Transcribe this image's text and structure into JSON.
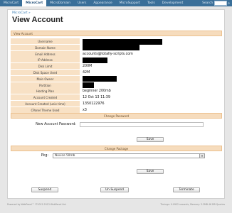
{
  "nav": {
    "items": [
      "MicroCart",
      "MicroCart",
      "MicroDomain",
      "Users",
      "Appearance",
      "MicroSupport",
      "Tools",
      "Development"
    ],
    "active_index": 1,
    "search_label": "Search"
  },
  "breadcrumb": "MicroCart »",
  "page_title": "View Account",
  "view_account_header": "View Account",
  "account_rows": [
    {
      "label": "Username",
      "value": "",
      "redacted": true
    },
    {
      "label": "Domain Name",
      "value": "",
      "redacted": true
    },
    {
      "label": "Email Address",
      "value": "accounts@totally-scripts.com",
      "redacted": false
    },
    {
      "label": "IP Address",
      "value": "",
      "redacted": true
    },
    {
      "label": "Disk Limit",
      "value": "200M",
      "redacted": false
    },
    {
      "label": "Disk Space Used",
      "value": "42M",
      "redacted": false
    },
    {
      "label": "Main Owner",
      "value": "",
      "redacted": true
    },
    {
      "label": "Partition",
      "value": "",
      "redacted": true
    },
    {
      "label": "Hosting Plan",
      "value": "beginner 200mb",
      "redacted": false
    },
    {
      "label": "Account Created",
      "value": "12 Oct 13 11:39",
      "redacted": false
    },
    {
      "label": "Account Created (unix time)",
      "value": "1350122976",
      "redacted": false
    },
    {
      "label": "CPanel Theme Used",
      "value": "x3",
      "redacted": false
    }
  ],
  "change_password": {
    "header": "Change Password",
    "label": "New Account Password:",
    "value": "",
    "save_label": "Save"
  },
  "change_package": {
    "header": "Change Package",
    "label": "Pkg:",
    "selected": "Novice 50mb",
    "save_label": "Save"
  },
  "actions": {
    "suspend": "Suspend",
    "unsuspend": "Un-Suspend",
    "terminate": "Terminate"
  },
  "footer": {
    "left": "Powered by WebPanel™ ©2012-2013 WebPanel Ltd.",
    "right": "Timings: 0.0952 seconds, Memory: 3.2MB 46 DB Queries"
  }
}
